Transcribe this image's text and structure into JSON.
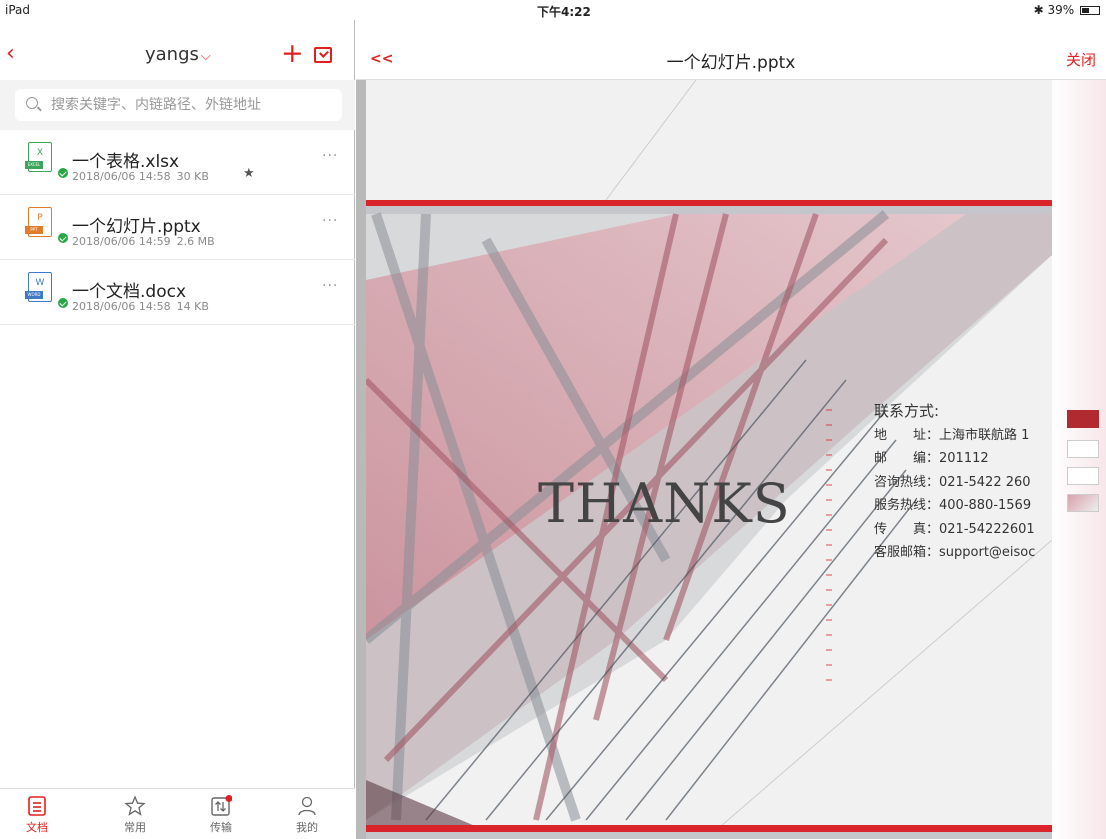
{
  "status_bar": {
    "device": "iPad",
    "time": "下午4:22",
    "battery": "39%"
  },
  "left_header": {
    "user": "yangs"
  },
  "search": {
    "placeholder": "搜索关键字、内链路径、外链地址"
  },
  "files": [
    {
      "name": "一个表格.xlsx",
      "date": "2018/06/06 14:58",
      "size": "30 KB",
      "starred": true,
      "type_letter": "X",
      "type_label": "EXCEL",
      "color": "#3aa55b"
    },
    {
      "name": "一个幻灯片.pptx",
      "date": "2018/06/06 14:59",
      "size": "2.6 MB",
      "starred": false,
      "type_letter": "P",
      "type_label": "PPT",
      "color": "#e07b2a"
    },
    {
      "name": "一个文档.docx",
      "date": "2018/06/06 14:58",
      "size": "14 KB",
      "starred": false,
      "type_letter": "W",
      "type_label": "WORD",
      "color": "#3f7ac9"
    }
  ],
  "tabs": [
    {
      "label": "文档",
      "icon": "document-icon",
      "active": true
    },
    {
      "label": "常用",
      "icon": "star-icon",
      "active": false
    },
    {
      "label": "传输",
      "icon": "transfer-icon",
      "active": false
    },
    {
      "label": "我的",
      "icon": "person-icon",
      "active": false
    }
  ],
  "viewer": {
    "back_label": "<<",
    "title": "一个幻灯片.pptx",
    "close_label": "关闭"
  },
  "slide": {
    "headline": "THANKS",
    "contact_title": "联系方式:",
    "contact_lines": [
      "地　　址：上海市联航路 1",
      "邮　　编：201112",
      "咨询热线：021-5422 260",
      "服务热线：400-880-1569",
      "传　　真：021-54222601",
      "客服邮箱：support@eisoc"
    ]
  },
  "colors": {
    "accent": "#e02020",
    "slide_red": "#d9242c",
    "slide_pink": "#d9a2ac"
  }
}
